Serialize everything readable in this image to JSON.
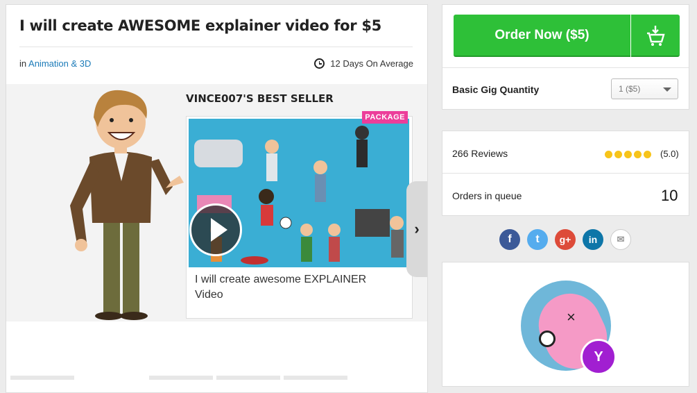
{
  "gig": {
    "title": "I will create AWESOME explainer video for $5",
    "category_prefix": "in",
    "category": "Animation & 3D",
    "delivery": "12 Days On Average"
  },
  "media": {
    "seller_label": "VINCE007'S BEST SELLER",
    "badge": "PACKAGE",
    "card_text": "I will create awesome EXPLAINER Video",
    "next_icon": "chevron-right-icon",
    "play_icon": "play-icon"
  },
  "order": {
    "button_label": "Order Now ($5)",
    "cart_icon": "cart-download-icon",
    "quantity_label": "Basic Gig Quantity",
    "quantity_selected": "1 ($5)"
  },
  "stats": {
    "reviews": "266 Reviews",
    "rating_text": "(5.0)",
    "stars": 5,
    "queue_label": "Orders in queue",
    "queue_count": "10"
  },
  "social": [
    {
      "name": "facebook-icon",
      "glyph": "f",
      "color": "#3b5998"
    },
    {
      "name": "twitter-icon",
      "glyph": "t",
      "color": "#55acee"
    },
    {
      "name": "google-plus-icon",
      "glyph": "g+",
      "color": "#dd4b39"
    },
    {
      "name": "linkedin-icon",
      "glyph": "in",
      "color": "#0e76a8"
    },
    {
      "name": "email-icon",
      "glyph": "✉",
      "color": "#ffffff"
    }
  ],
  "colors": {
    "accent_green": "#2ec038",
    "link_blue": "#1a7ab8",
    "badge_pink": "#ec3e9a",
    "level_purple": "#a11fd1"
  }
}
